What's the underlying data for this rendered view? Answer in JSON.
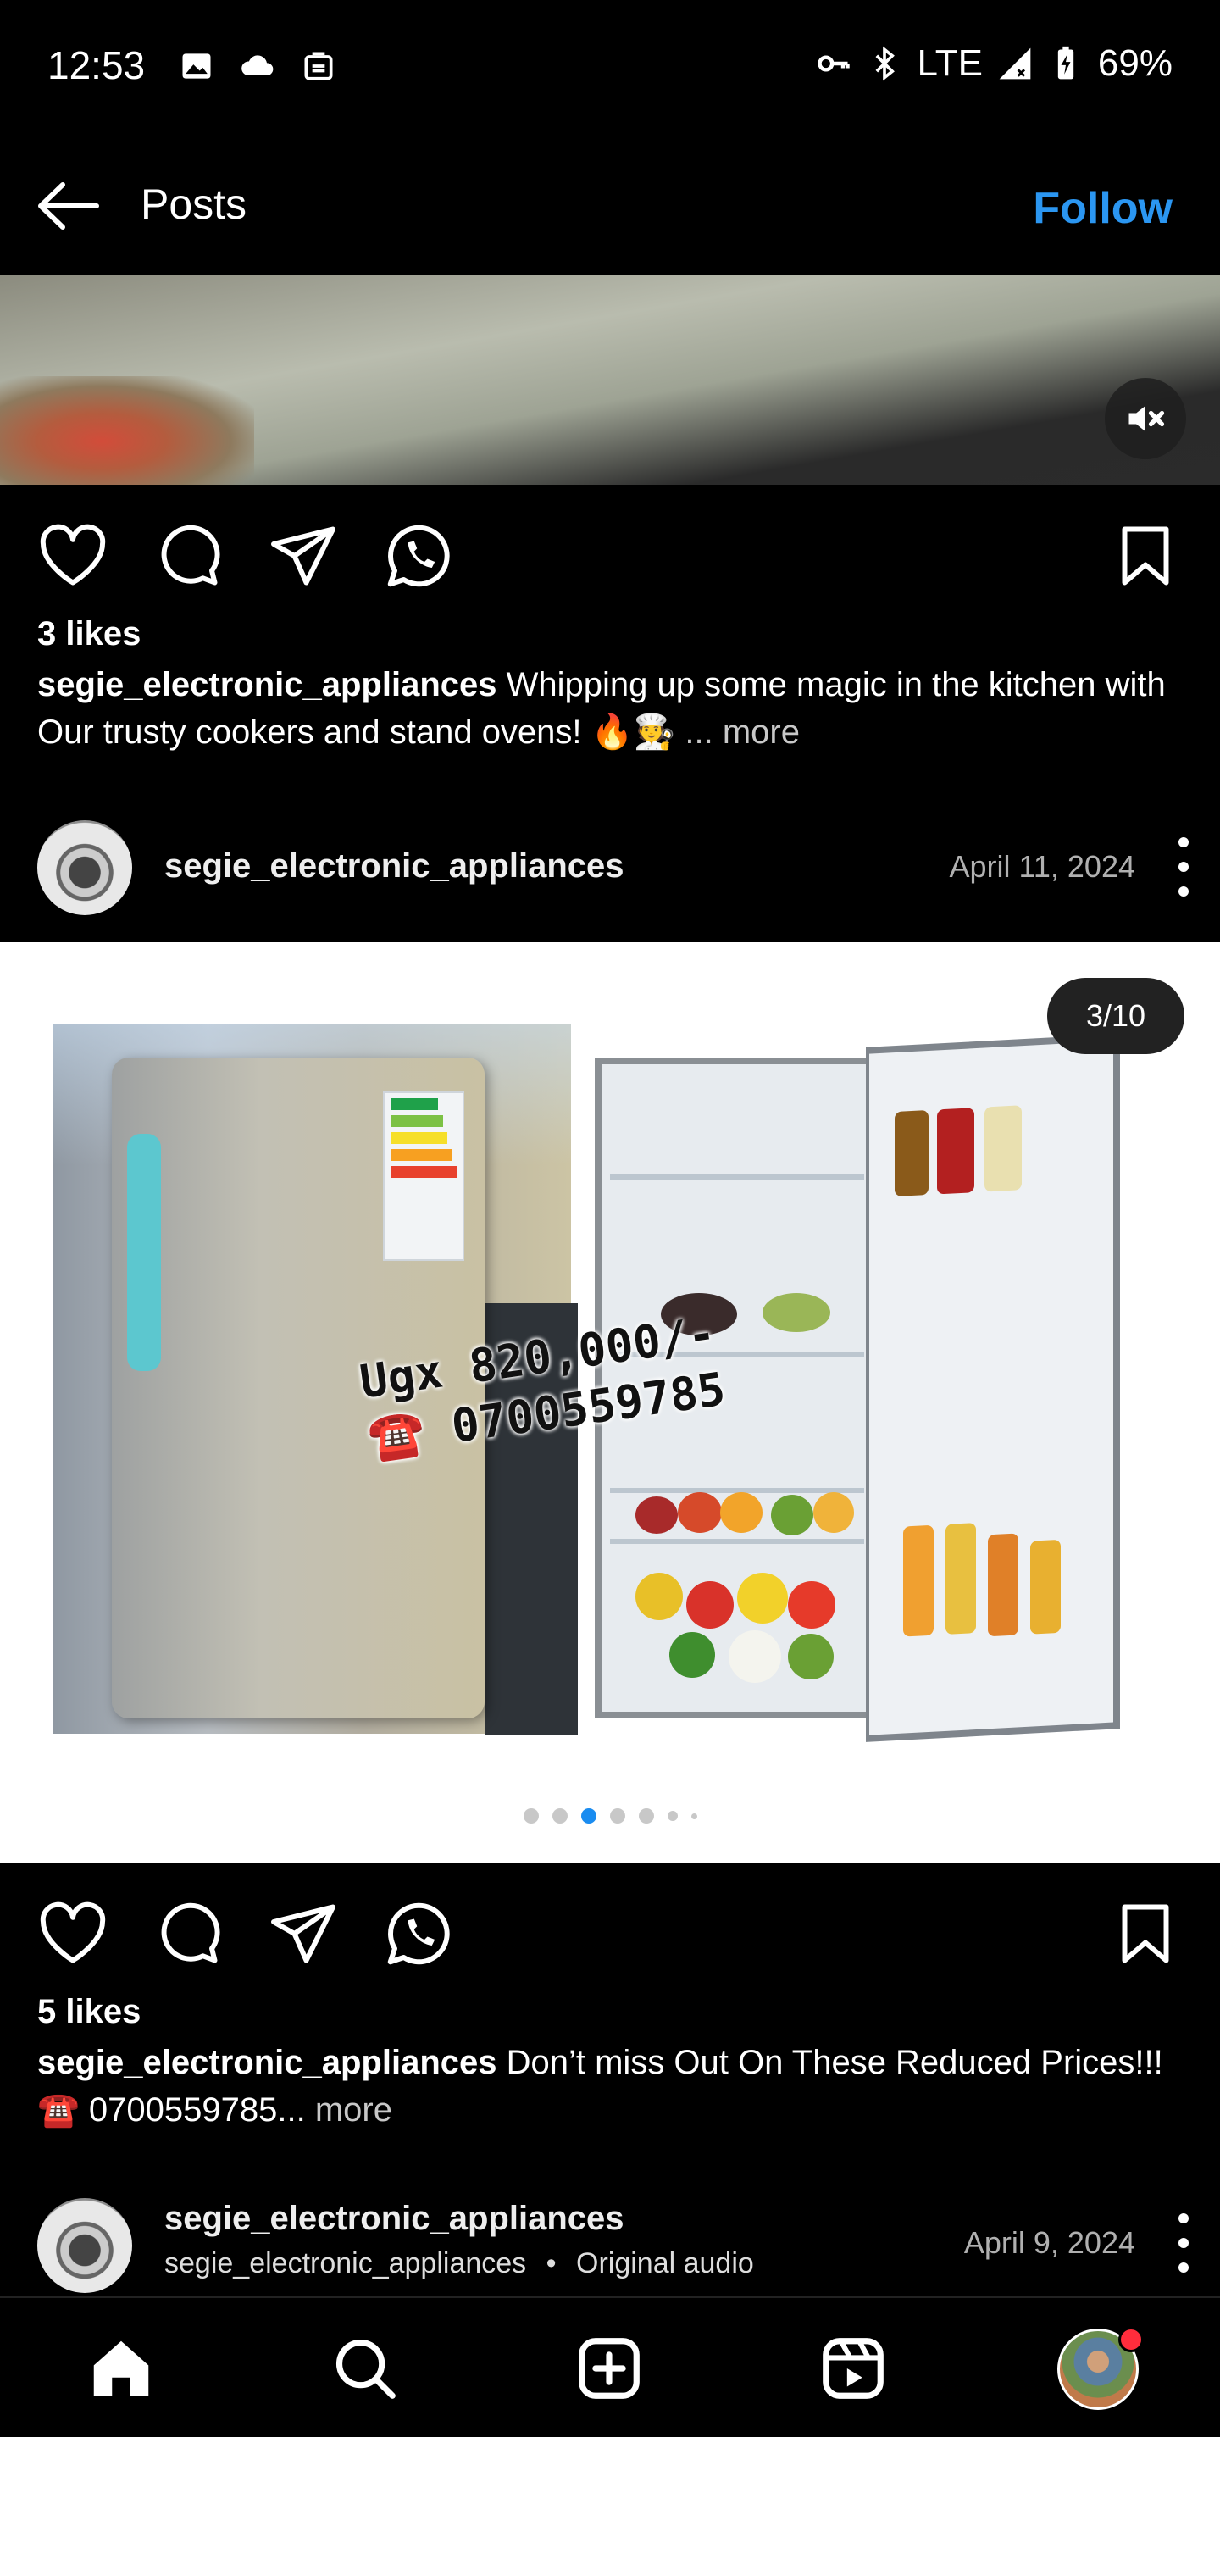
{
  "status_bar": {
    "time": "12:53",
    "network": "LTE",
    "battery": "69%",
    "left_icons": [
      "photo-notification-icon",
      "cloud-icon",
      "sim-alert-icon"
    ],
    "right_icons": [
      "vpn-key-icon",
      "bluetooth-icon",
      "signal-icon",
      "battery-charging-icon"
    ]
  },
  "header": {
    "title": "Posts",
    "follow_label": "Follow",
    "accent_color": "#2b96f1"
  },
  "post1": {
    "likes": "3 likes",
    "username": "segie_electronic_appliances",
    "caption_text": " Whipping up some magic in the kitchen with Our trusty cookers and stand ovens! 🔥🧑‍🍳",
    "more": " ... more"
  },
  "post2": {
    "username": "segie_electronic_appliances",
    "date": "April 11, 2024",
    "counter": "3/10",
    "overlay_price": "Ugx 820,000/-",
    "overlay_phone": "☎️ 0700559785",
    "carousel_active_index": 2,
    "likes": "5 likes",
    "caption_text": " Don’t miss Out On These Reduced Prices!!! ☎️ 0700559785...",
    "more": " more"
  },
  "post3": {
    "username": "segie_electronic_appliances",
    "subtitle_user": "segie_electronic_appliances",
    "subtitle_audio": "Original audio",
    "subtitle_separator": "•",
    "date": "April 9, 2024"
  },
  "bottom_nav": {
    "items": [
      "home-icon",
      "search-icon",
      "create-icon",
      "reels-icon",
      "profile-avatar"
    ]
  }
}
